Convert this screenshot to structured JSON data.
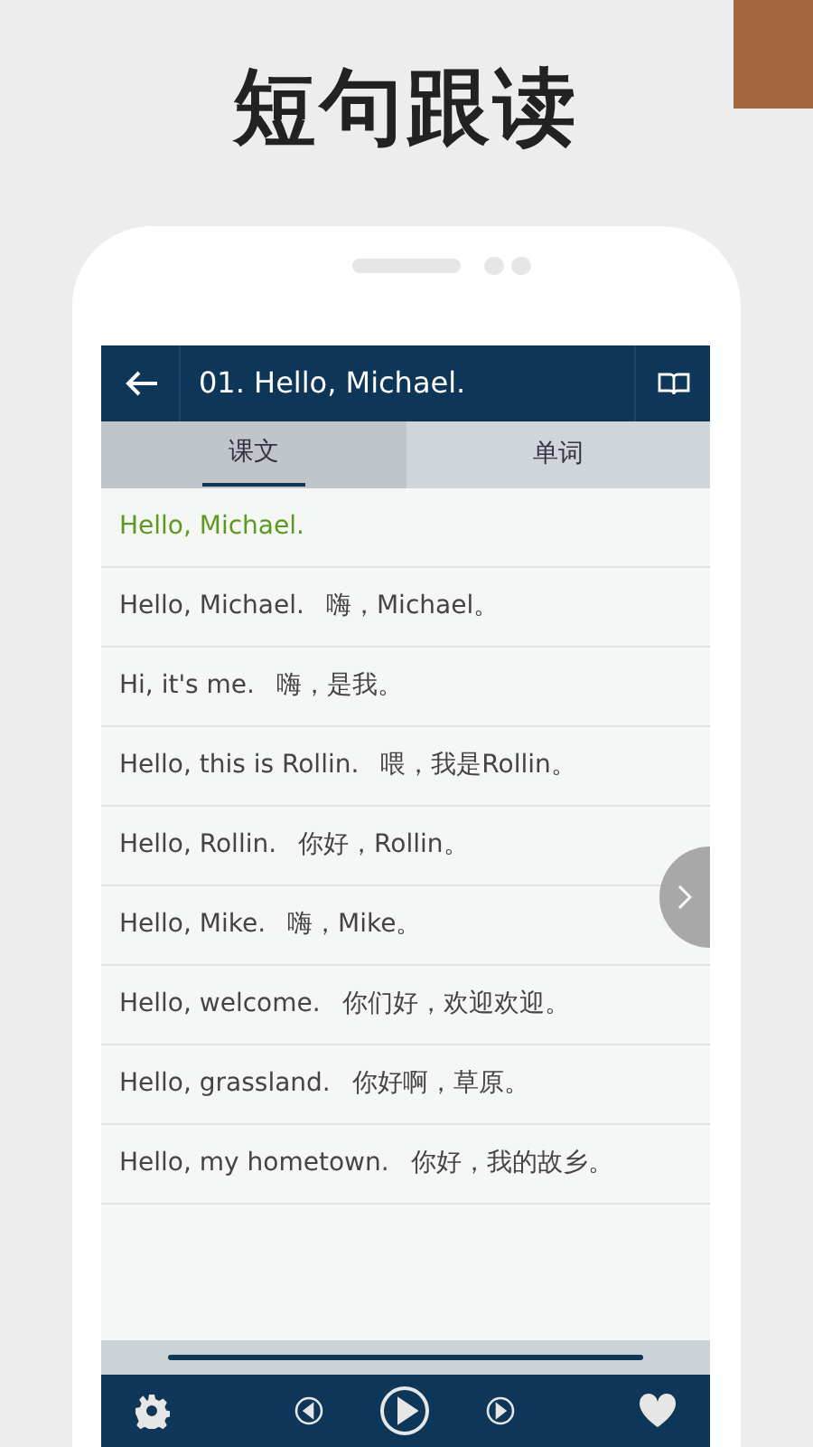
{
  "headline": "短句跟读",
  "header": {
    "title": "01. Hello, Michael."
  },
  "tabs": [
    {
      "label": "课文",
      "selected": true
    },
    {
      "label": "单词",
      "selected": false
    }
  ],
  "sentences": [
    {
      "english": "Hello, Michael.",
      "selected": true
    },
    {
      "english": "Hello, Michael.",
      "chinese": "嗨，Michael。",
      "selected": false
    },
    {
      "english": "Hi, it's me.",
      "chinese": "嗨，是我。",
      "selected": false
    },
    {
      "english": "Hello, this is Rollin.",
      "chinese": "喂，我是Rollin。",
      "selected": false
    },
    {
      "english": "Hello, Rollin.",
      "chinese": "你好，Rollin。",
      "selected": false
    },
    {
      "english": "Hello, Mike.",
      "chinese": "嗨，Mike。",
      "selected": false
    },
    {
      "english": "Hello, welcome.",
      "chinese": "你们好，欢迎欢迎。",
      "selected": false
    },
    {
      "english": "Hello, grassland.",
      "chinese": "你好啊，草原。",
      "selected": false
    },
    {
      "english": "Hello, my hometown.",
      "chinese": "你好，我的故乡。",
      "selected": false
    }
  ]
}
